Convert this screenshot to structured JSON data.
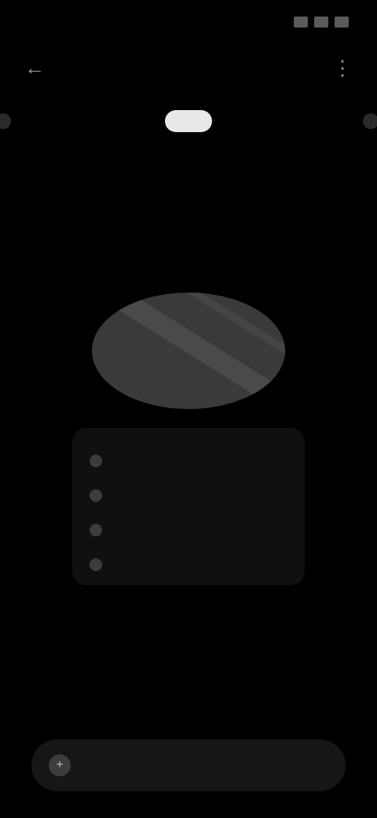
{
  "status_bar": {
    "time": "",
    "icons": [
      "signal-icon",
      "wifi-icon",
      "battery-icon"
    ]
  },
  "top_bar": {
    "back_icon": "back-arrow-icon",
    "title": "",
    "menu_icon": "more-icon"
  },
  "tabs": {
    "items": [
      {
        "label": ""
      },
      {
        "label": ""
      },
      {
        "label": ""
      }
    ],
    "active_index": 1
  },
  "empty_state": {
    "rows": [
      {
        "icon": "bullet-icon",
        "text": ""
      },
      {
        "icon": "bullet-icon",
        "text": ""
      },
      {
        "icon": "bullet-icon",
        "text": ""
      },
      {
        "icon": "bullet-icon",
        "text": ""
      }
    ]
  },
  "bottom_bar": {
    "icon": "add-icon",
    "label": ""
  },
  "colors": {
    "background": "#000000",
    "active_tab": "#e8e8e8"
  }
}
